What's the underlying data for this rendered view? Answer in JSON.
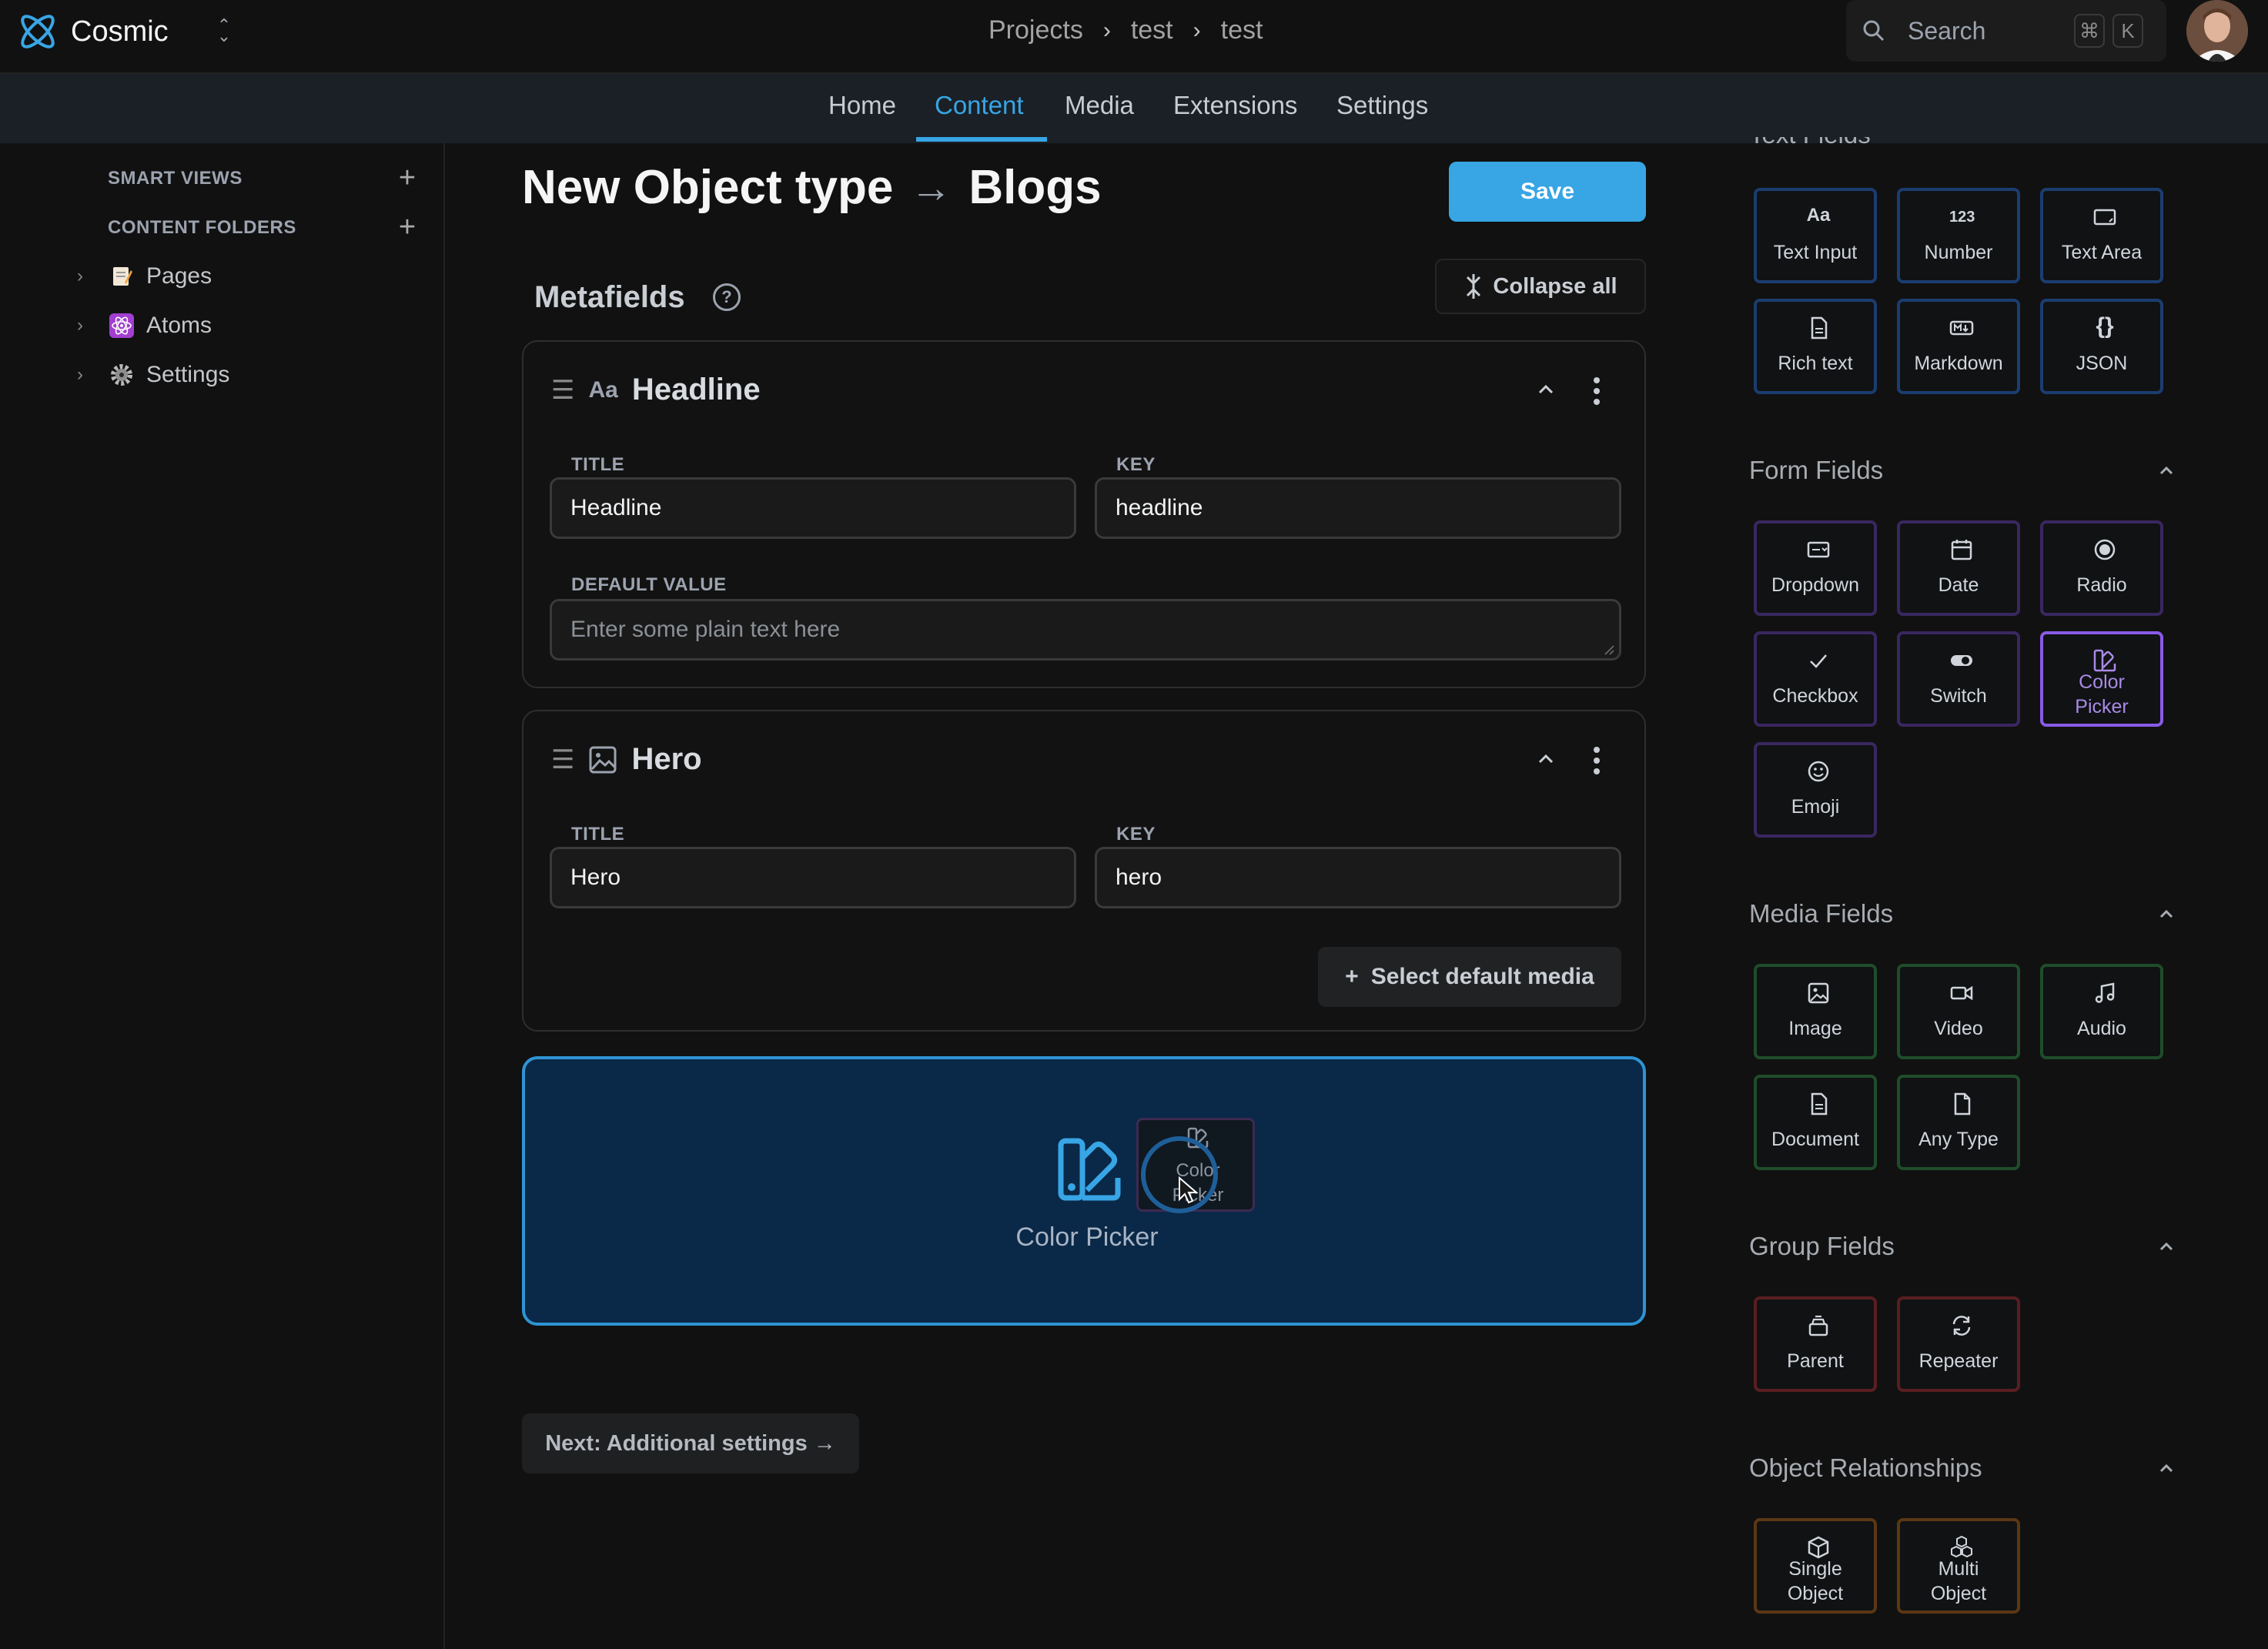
{
  "app": {
    "brand": "Cosmic",
    "breadcrumbs": [
      "Projects",
      "test",
      "test"
    ],
    "search_placeholder": "Search",
    "shortcut": [
      "⌘",
      "K"
    ]
  },
  "nav": {
    "tabs": [
      "Home",
      "Content",
      "Media",
      "Extensions",
      "Settings"
    ],
    "active": "Content"
  },
  "sidebar": {
    "smart_views": "SMART VIEWS",
    "content_folders": "CONTENT FOLDERS",
    "items": [
      {
        "label": "Pages",
        "icon": "memo-emoji"
      },
      {
        "label": "Atoms",
        "icon": "atom-emoji"
      },
      {
        "label": "Settings",
        "icon": "gear-emoji"
      }
    ]
  },
  "main": {
    "title_prefix": "New Object type",
    "title_name": "Blogs",
    "save_label": "Save",
    "metafields_label": "Metafields",
    "collapse_all_label": "Collapse all",
    "cards": [
      {
        "name": "Headline",
        "type_icon": "Aa",
        "title_label": "TITLE",
        "title_value": "Headline",
        "key_label": "KEY",
        "key_value": "headline",
        "default_label": "DEFAULT VALUE",
        "default_placeholder": "Enter some plain text here"
      },
      {
        "name": "Hero",
        "type_icon": "image-icon",
        "title_label": "TITLE",
        "title_value": "Hero",
        "key_label": "KEY",
        "key_value": "hero",
        "media_button": "Select default media"
      }
    ],
    "dropzone_label": "Color Picker",
    "drag_ghost": [
      "Color",
      "Picker"
    ],
    "next_label": "Next: Additional settings →"
  },
  "panel": {
    "sections": {
      "text": "Text Fields",
      "form": "Form Fields",
      "media": "Media Fields",
      "group": "Group Fields",
      "relations": "Object Relationships"
    },
    "text_fields": [
      "Text Input",
      "Number",
      "Text Area",
      "Rich text",
      "Markdown",
      "JSON"
    ],
    "form_fields": [
      "Dropdown",
      "Date",
      "Radio",
      "Checkbox",
      "Switch",
      "Color Picker",
      "Emoji"
    ],
    "form_selected": "Color Picker",
    "media_fields": [
      "Image",
      "Video",
      "Audio",
      "Document",
      "Any Type"
    ],
    "group_fields": [
      "Parent",
      "Repeater"
    ],
    "relation_fields": [
      "Single Object",
      "Multi Object"
    ]
  },
  "colors": {
    "accent": "#38a5e5",
    "dropzone_bg": "#0a2847",
    "selected_tile": "#8a5ae6"
  }
}
